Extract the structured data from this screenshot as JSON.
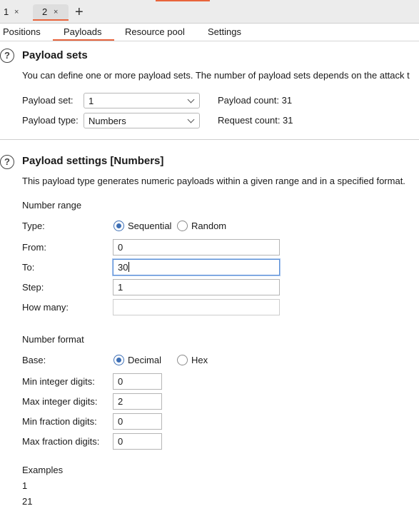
{
  "tabs": [
    {
      "label": "1",
      "close": "×"
    },
    {
      "label": "2",
      "close": "×"
    }
  ],
  "new_tab_label": "+",
  "subtabs": [
    "Positions",
    "Payloads",
    "Resource pool",
    "Settings"
  ],
  "help_glyph": "?",
  "payload_sets": {
    "title": "Payload sets",
    "description": "You can define one or more payload sets. The number of payload sets depends on the attack t",
    "set_label": "Payload set:",
    "set_value": "1",
    "type_label": "Payload type:",
    "type_value": "Numbers",
    "payload_count": "Payload count: 31",
    "request_count": "Request count: 31"
  },
  "payload_settings": {
    "title": "Payload settings [Numbers]",
    "description": "This payload type generates numeric payloads within a given range and in a specified format.",
    "number_range": {
      "heading": "Number range",
      "type_label": "Type:",
      "sequential": "Sequential",
      "random": "Random",
      "from_label": "From:",
      "from_value": "0",
      "to_label": "To:",
      "to_value": "30",
      "step_label": "Step:",
      "step_value": "1",
      "how_many_label": "How many:",
      "how_many_value": ""
    },
    "number_format": {
      "heading": "Number format",
      "base_label": "Base:",
      "decimal": "Decimal",
      "hex": "Hex",
      "min_int_label": "Min integer digits:",
      "min_int_value": "0",
      "max_int_label": "Max integer digits:",
      "max_int_value": "2",
      "min_frac_label": "Min fraction digits:",
      "min_frac_value": "0",
      "max_frac_label": "Max fraction digits:",
      "max_frac_value": "0"
    },
    "examples": {
      "heading": "Examples",
      "values": [
        "1",
        "21"
      ]
    }
  },
  "colors": {
    "accent": "#e8643c",
    "radio_selected": "#3d6fb5",
    "focus_border": "#5b8fd6"
  }
}
